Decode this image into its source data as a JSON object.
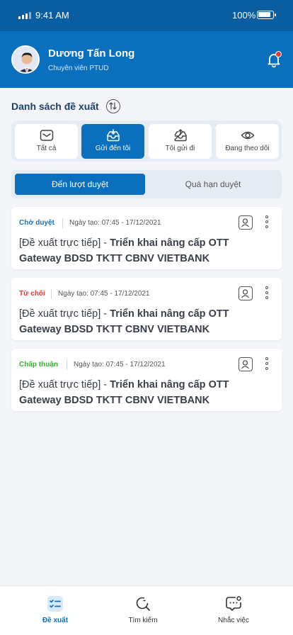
{
  "status_bar": {
    "time": "9:41 AM",
    "battery": "100%"
  },
  "user": {
    "name": "Dương Tấn Long",
    "role": "Chuyên viên PTUD"
  },
  "section": {
    "title": "Danh sách đề xuất"
  },
  "filters": [
    {
      "label": "Tất cả",
      "icon": "inbox-icon",
      "active": false
    },
    {
      "label": "Gửi đến tôi",
      "icon": "inbox-incoming-icon",
      "active": true
    },
    {
      "label": "Tôi gửi đi",
      "icon": "outbox-icon",
      "active": false
    },
    {
      "label": "Đang theo dõi",
      "icon": "eye-icon",
      "active": false
    }
  ],
  "segments": [
    {
      "label": "Đến lượt duyệt",
      "active": true
    },
    {
      "label": "Quá hạn duyệt",
      "active": false
    }
  ],
  "cards": [
    {
      "status": "Chờ duyệt",
      "status_color": "#1a6fb8",
      "created": "Ngày tạo: 07:45 - 17/12/2021",
      "prefix": "[Đề xuất trực tiếp] - ",
      "title": "Triển khai nâng cấp OTT Gateway BDSD TKTT CBNV VIETBANK"
    },
    {
      "status": "Từ chối",
      "status_color": "#e53935",
      "created": "Ngày tạo: 07:45 - 17/12/2021",
      "prefix": "[Đề xuất trực tiếp] - ",
      "title": "Triển khai nâng cấp OTT Gateway BDSD TKTT CBNV VIETBANK"
    },
    {
      "status": "Chấp thuận",
      "status_color": "#35b02e",
      "created": "Ngày tạo: 07:45 - 17/12/2021",
      "prefix": "[Đề xuất trực tiếp] - ",
      "title": "Triển khai nâng cấp OTT Gateway BDSD TKTT CBNV VIETBANK"
    }
  ],
  "tabs": [
    {
      "label": "Đề xuất",
      "icon": "checklist-icon",
      "active": true
    },
    {
      "label": "Tìm kiếm",
      "icon": "search-icon",
      "active": false
    },
    {
      "label": "Nhắc việc",
      "icon": "chat-reminder-icon",
      "active": false
    }
  ],
  "colors": {
    "brand": "#0a6fbd",
    "header_dark": "#0a5d9f",
    "notification": "#e53935"
  }
}
